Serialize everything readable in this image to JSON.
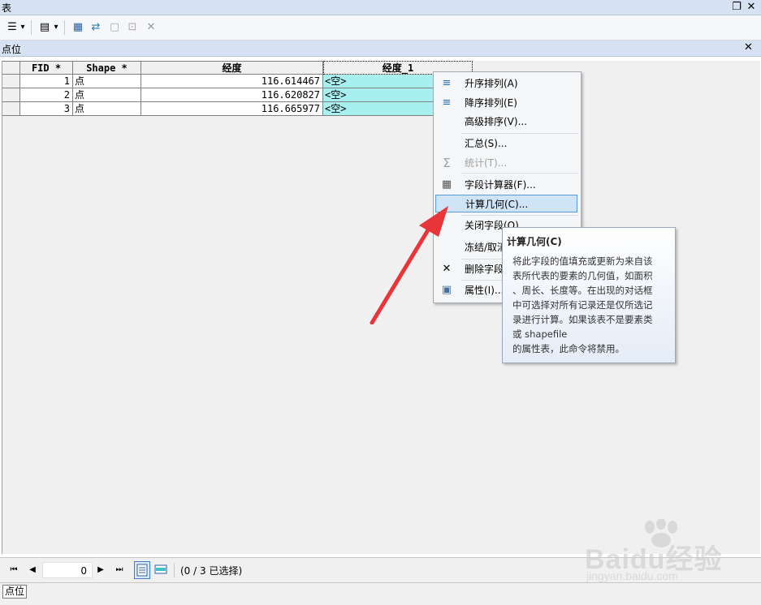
{
  "window": {
    "title": "表",
    "restore_glyph": "❐",
    "close_glyph": "✕"
  },
  "toolbar": {
    "icons": [
      "table-options-icon",
      "dropdown-arrow-icon",
      "related-tables-icon",
      "dropdown-arrow-icon",
      "select-by-attributes-icon",
      "switch-selection-icon",
      "clear-selection-icon",
      "zoom-to-selected-icon",
      "delete-selected-icon"
    ],
    "glyphs": {
      "options": "☰",
      "arrow": "▾",
      "related": "▤",
      "select": "▦",
      "switch": "⇄",
      "clear": "▢",
      "zoom": "⊡",
      "delete": "✕"
    }
  },
  "tab": {
    "title": "点位",
    "close_glyph": "✕"
  },
  "table": {
    "columns": [
      "FID *",
      "Shape *",
      "经度",
      "经度_1"
    ],
    "rows": [
      {
        "fid": "1",
        "shape": "点",
        "lon": "116.614467",
        "lon1": "<空>"
      },
      {
        "fid": "2",
        "shape": "点",
        "lon": "116.620827",
        "lon1": "<空>"
      },
      {
        "fid": "3",
        "shape": "点",
        "lon": "116.665977",
        "lon1": "<空>"
      }
    ]
  },
  "context_menu": {
    "items": [
      {
        "label": "升序排列(A)",
        "icon": "sort-ascending-icon",
        "glyph": "≡",
        "enabled": true
      },
      {
        "label": "降序排列(E)",
        "icon": "sort-descending-icon",
        "glyph": "≡",
        "enabled": true
      },
      {
        "label": "高级排序(V)...",
        "icon": "",
        "glyph": "",
        "enabled": true
      },
      {
        "label": "汇总(S)...",
        "icon": "",
        "glyph": "",
        "enabled": true
      },
      {
        "label": "统计(T)...",
        "icon": "sigma-icon",
        "glyph": "Σ",
        "enabled": false
      },
      {
        "label": "字段计算器(F)...",
        "icon": "calculator-icon",
        "glyph": "▦",
        "enabled": true
      },
      {
        "label": "计算几何(C)...",
        "icon": "",
        "glyph": "",
        "enabled": true,
        "highlighted": true
      },
      {
        "label": "关闭字段(O)",
        "icon": "",
        "glyph": "",
        "enabled": true
      },
      {
        "label": "冻结/取消冻结列(Z)",
        "icon": "",
        "glyph": "",
        "enabled": true
      },
      {
        "label": "删除字段(D)",
        "icon": "delete-field-icon",
        "glyph": "✕",
        "enabled": true
      },
      {
        "label": "属性(I)...",
        "icon": "properties-icon",
        "glyph": "▣",
        "enabled": true
      }
    ]
  },
  "tooltip": {
    "title": "计算几何(C)",
    "body": "将此字段的值填充或更新为来自该\n表所代表的要素的几何值，如面积\n、周长、长度等。在出现的对话框\n中可选择对所有记录还是仅所选记\n录进行计算。如果该表不是要素类\n或 shapefile\n的属性表，此命令将禁用。"
  },
  "navigation": {
    "record_value": "0",
    "glyphs": {
      "first": "⏮",
      "prev": "◀",
      "next": "▶",
      "last": "⏭"
    },
    "selection_text": "(0 / 3 已选择)"
  },
  "bottom_tab": {
    "label": "点位"
  },
  "watermark": {
    "brand": "Baidu经验",
    "url": "jingyan.baidu.com"
  },
  "colors": {
    "selected_column": "#a8f0f0",
    "menu_highlight": "#cfe4f7",
    "arrow": "#e8353a"
  }
}
